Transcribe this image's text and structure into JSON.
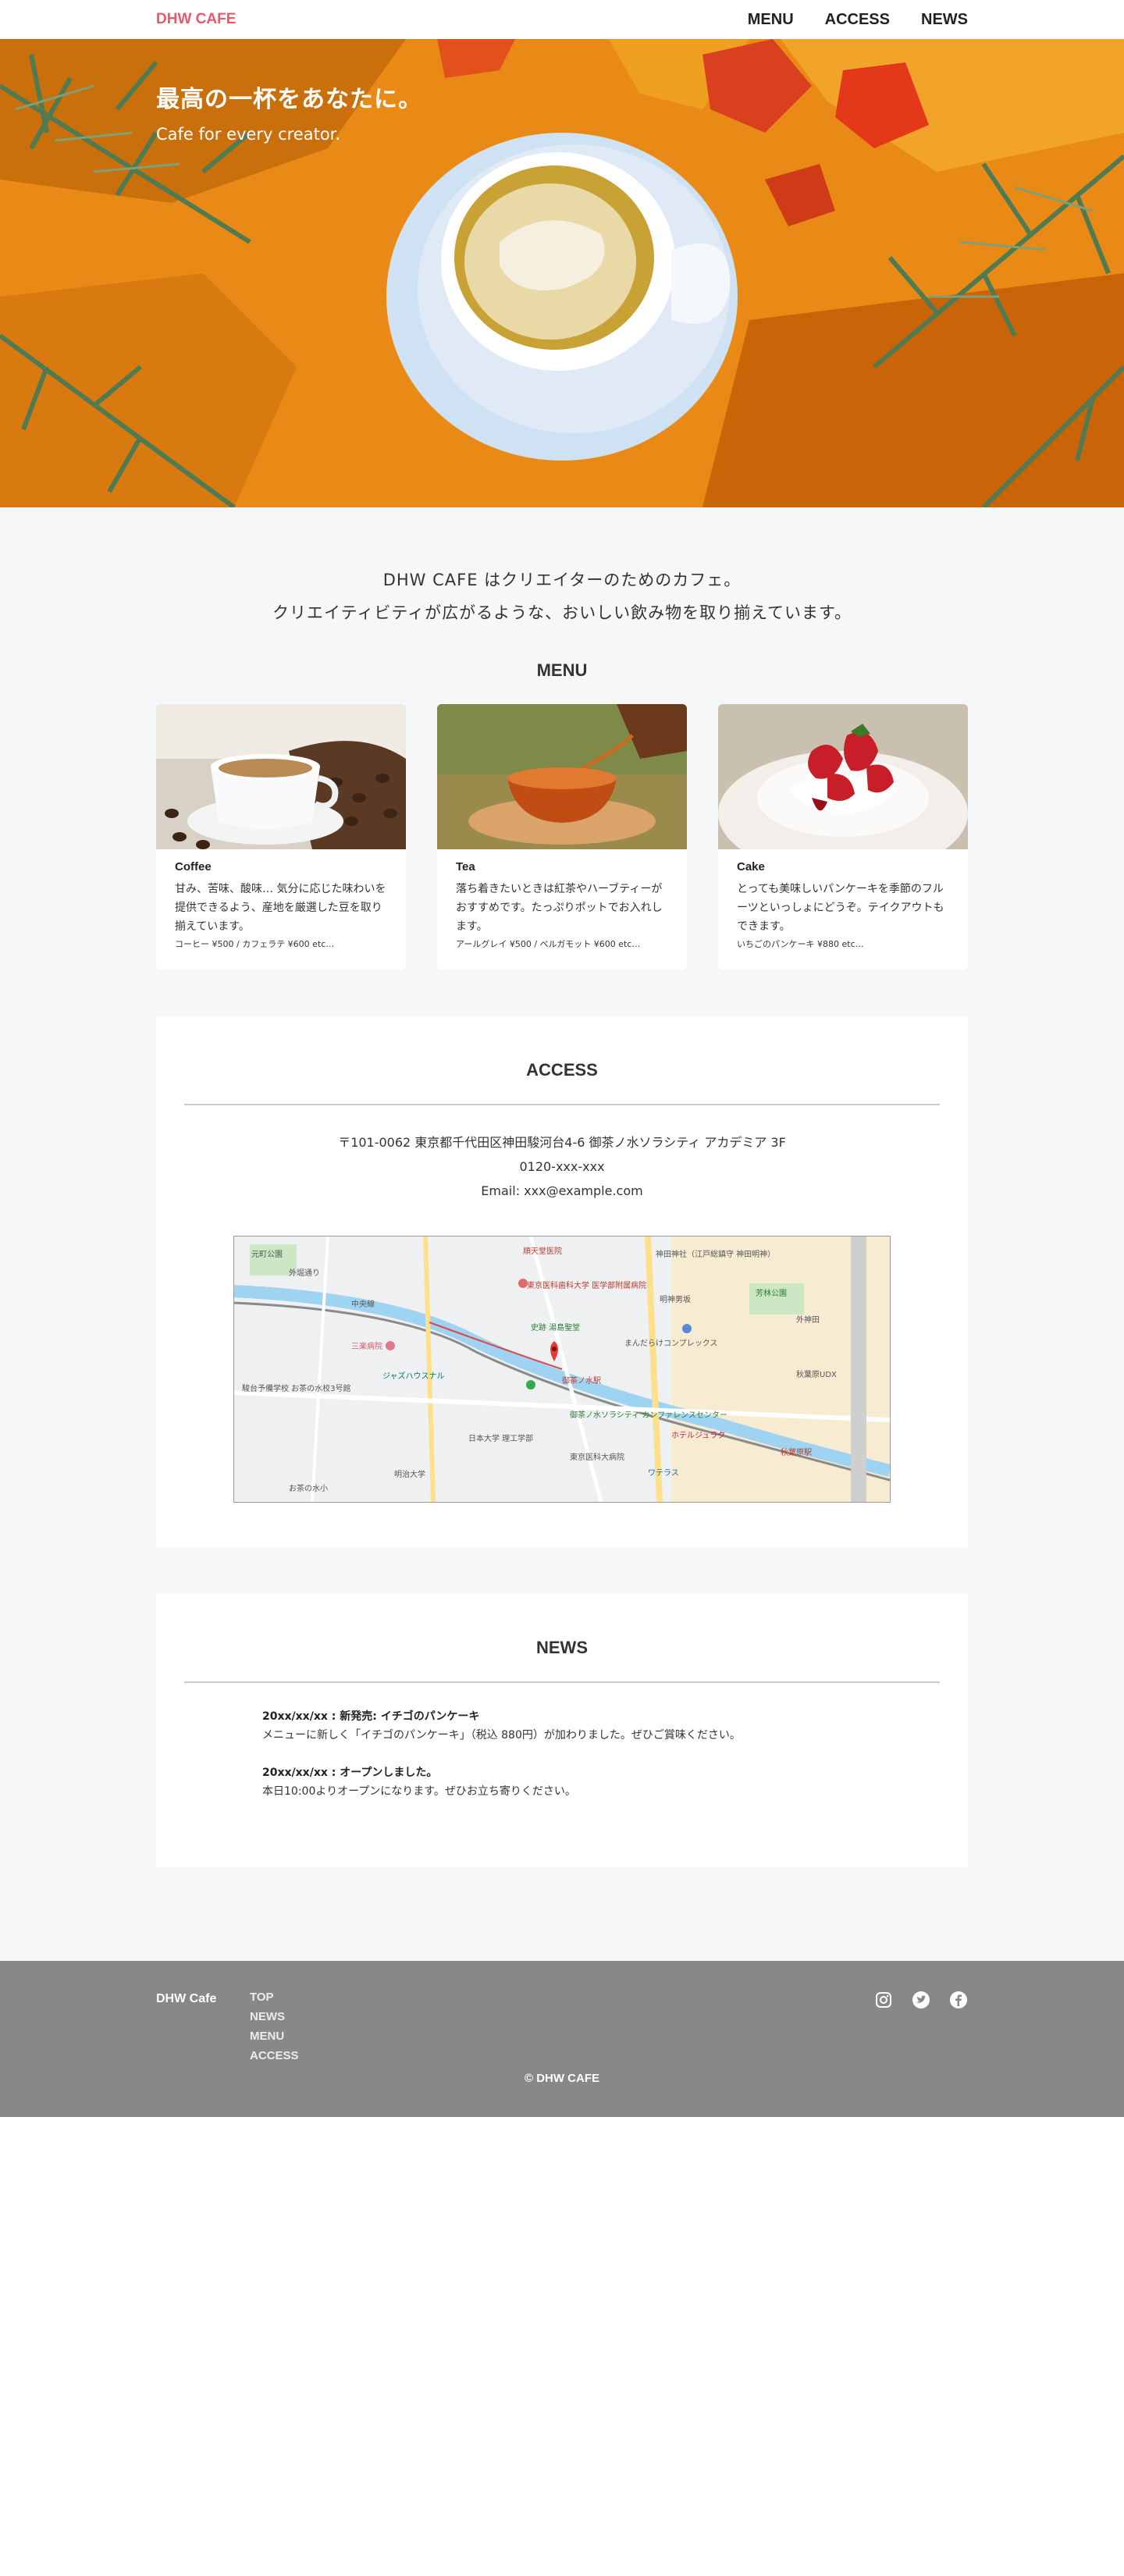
{
  "header": {
    "logo": "DHW CAFE",
    "nav": [
      "MENU",
      "ACCESS",
      "NEWS"
    ]
  },
  "hero": {
    "title": "最高の一杯をあなたに。",
    "subtitle": "Cafe for every creator."
  },
  "intro": {
    "line1": "DHW CAFE はクリエイターのためのカフェ。",
    "line2": "クリエイティビティが広がるような、おいしい飲み物を取り揃えています。"
  },
  "menu": {
    "title": "MENU",
    "items": [
      {
        "name": "Coffee",
        "desc": "甘み、苦味、酸味… 気分に応じた味わいを提供できるよう、産地を厳選した豆を取り揃えています。",
        "price": "コーヒー ¥500 / カフェラテ ¥600 etc…"
      },
      {
        "name": "Tea",
        "desc": "落ち着きたいときは紅茶やハーブティーがおすすめです。たっぷりポットでお入れします。",
        "price": "アールグレイ ¥500 / ベルガモット ¥600 etc…"
      },
      {
        "name": "Cake",
        "desc": "とっても美味しいパンケーキを季節のフルーツといっしょにどうぞ。テイクアウトもできます。",
        "price": "いちごのパンケーキ ¥880 etc…"
      }
    ]
  },
  "access": {
    "title": "ACCESS",
    "address": "〒101-0062 東京都千代田区神田駿河台4-6 御茶ノ水ソラシティ アカデミア 3F",
    "tel": "0120-xxx-xxx",
    "email": "Email:  xxx@example.com",
    "map_labels": [
      "元町公園",
      "外堀通り",
      "順天堂医院",
      "東京医科歯科大学 医学部附属病院",
      "神田神社（江戸総鎮守 神田明神）",
      "芳林公園",
      "史跡 湯島聖堂",
      "明神男坂",
      "中央線",
      "まんだらけコンプレックス",
      "三楽病院",
      "御茶ノ水駅",
      "ジャズハウスナル",
      "駿台予備学校 お茶の水校3号館",
      "御茶ノ水ソラシティ カンファレンスセンター",
      "ホテルジュラク",
      "日本大学 理工学部",
      "東京医科大病院",
      "秋葉原UDX",
      "秋葉原駅",
      "ワテラス",
      "明治大学",
      "お茶の水小",
      "外神田"
    ],
    "colors": {
      "pin": "#e53935",
      "river": "#9fd3f2",
      "road": "#ffe08a"
    }
  },
  "news": {
    "title": "NEWS",
    "items": [
      {
        "date": "20xx/xx/xx",
        "headline": "新発売: イチゴのパンケーキ",
        "body": "メニューに新しく「イチゴのパンケーキ」（税込 880円）が加わりました。ぜひご賞味ください。"
      },
      {
        "date": "20xx/xx/xx",
        "headline": "オープンしました。",
        "body": "本日10:00よりオープンになります。ぜひお立ち寄りください。"
      }
    ]
  },
  "footer": {
    "brand": "DHW Cafe",
    "nav": [
      "TOP",
      "NEWS",
      "MENU",
      "ACCESS"
    ],
    "social": [
      "instagram-icon",
      "twitter-icon",
      "facebook-icon"
    ],
    "copyright": "© DHW CAFE"
  },
  "colors": {
    "logo": "#e8596c",
    "hero_bg": "#e98a16",
    "section_bg": "#f6f7f9",
    "footer_bg": "#888888"
  }
}
